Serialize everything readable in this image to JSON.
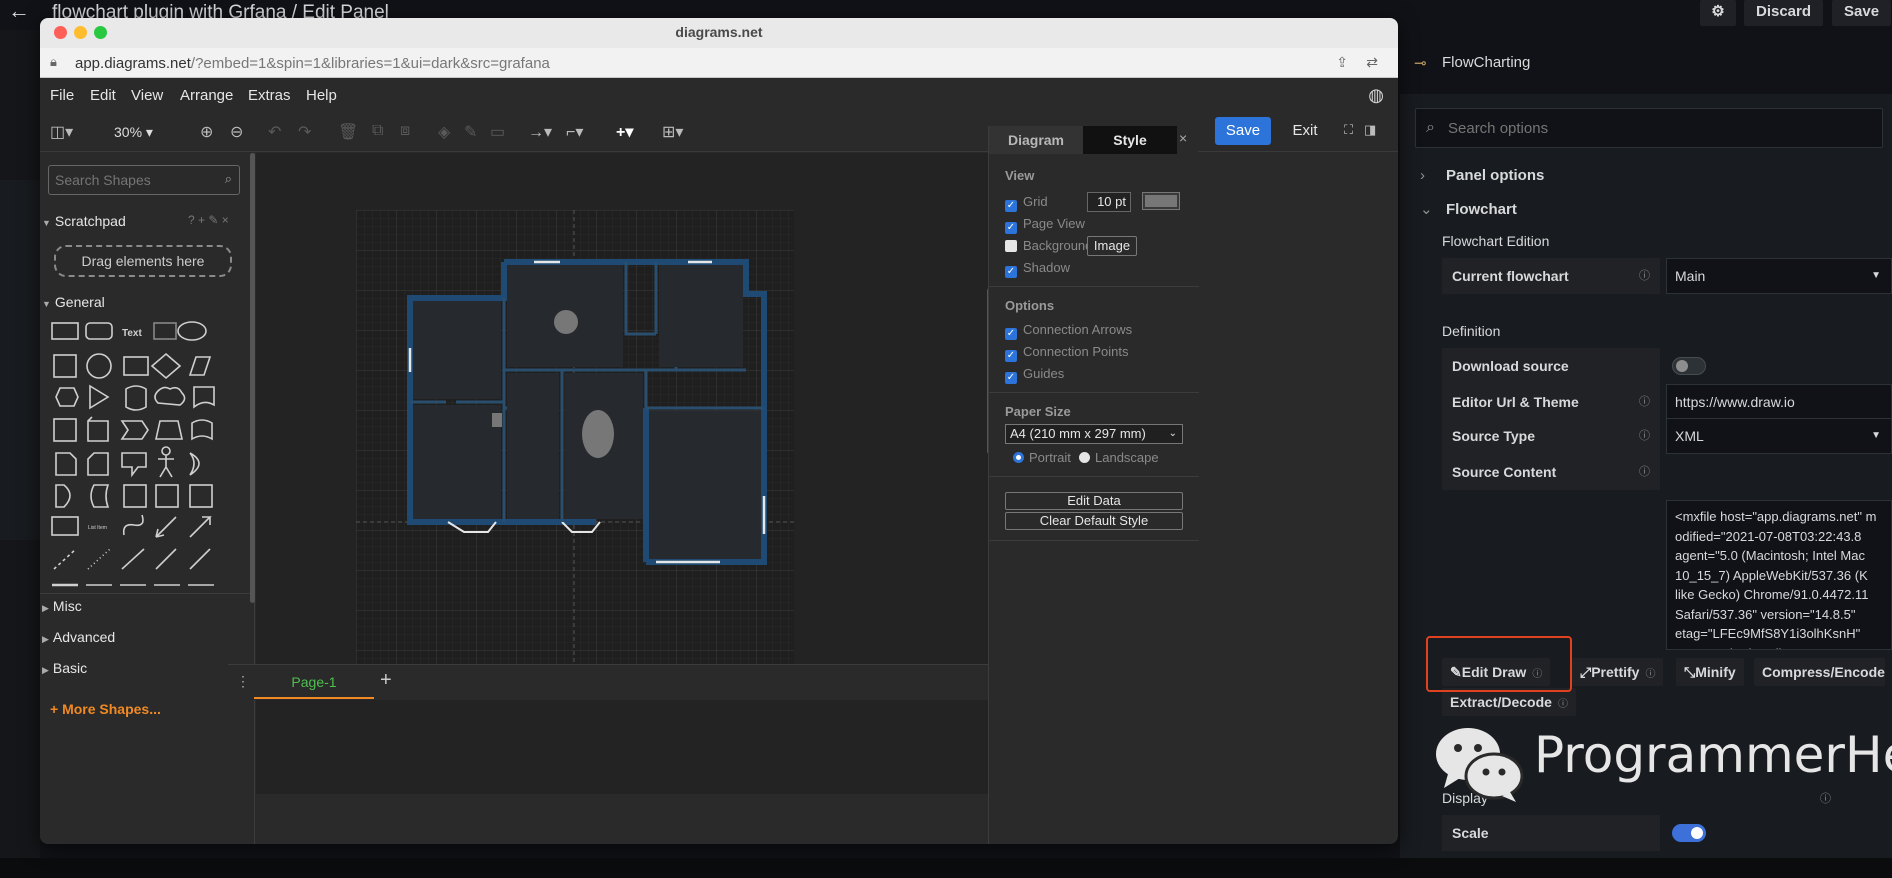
{
  "grafana": {
    "back_icon": "arrow-left-icon",
    "title": "flowchart plugin with Grfana / Edit Panel",
    "settings_icon": "gear-icon",
    "discard_label": "Discard",
    "save_label": "Save"
  },
  "options_pane": {
    "plugin_title": "FlowCharting",
    "search_placeholder": "Search options",
    "panel_options": "Panel options",
    "flowchart": "Flowchart",
    "flowchart_edition": "Flowchart Edition",
    "current_flowchart_label": "Current flowchart",
    "current_flowchart_value": "Main",
    "definition": "Definition",
    "download_source_label": "Download source",
    "download_source_on": false,
    "editor_url_label": "Editor Url & Theme",
    "editor_url_value": "https://www.draw.io",
    "source_type_label": "Source Type",
    "source_type_value": "XML",
    "source_content_label": "Source Content",
    "source_content_value": "<mxfile host=\"app.diagrams.net\" modified=\"2021-07-08T03:22:43.8\nagent=\"5.0 (Macintosh; Intel Mac\n10_15_7) AppleWebKit/537.36 (K\nlike Gecko) Chrome/91.0.4472.11\nSafari/537.36\" version=\"14.8.5\"\netag=\"LFEc9MfS8Y1i3olhKsnH\"\ntype=\"embed\"><diagram",
    "buttons": {
      "edit_draw": "Edit Draw",
      "prettify": "Prettify",
      "minify": "Minify",
      "compress": "Compress/Encode",
      "extract": "Extract/Decode"
    },
    "display": "Display",
    "scale_label": "Scale",
    "scale_on": true
  },
  "watermark": {
    "text": "ProgrammerHe"
  },
  "drawio": {
    "window_title": "diagrams.net",
    "url_host": "app.diagrams.net",
    "url_path": "/?embed=1&spin=1&libraries=1&ui=dark&src=grafana",
    "menu": [
      "File",
      "Edit",
      "View",
      "Arrange",
      "Extras",
      "Help"
    ],
    "zoom": "30%",
    "save_label": "Save",
    "exit_label": "Exit",
    "shape_search_placeholder": "Search Shapes",
    "scratchpad": "Scratchpad",
    "scratchpad_tools": "? + ✎ ×",
    "drag_here": "Drag elements here",
    "general": "General",
    "misc": "Misc",
    "advanced": "Advanced",
    "basic": "Basic",
    "more_shapes": "+ More Shapes...",
    "page_tab": "Page-1",
    "format": {
      "tab_diagram": "Diagram",
      "tab_style": "Style",
      "view": "View",
      "grid": "Grid",
      "grid_size": "10 pt",
      "page_view": "Page View",
      "background": "Background",
      "image_btn": "Image",
      "shadow": "Shadow",
      "options": "Options",
      "connection_arrows": "Connection Arrows",
      "connection_points": "Connection Points",
      "guides": "Guides",
      "paper_size": "Paper Size",
      "paper_value": "A4 (210 mm x 297 mm)",
      "portrait": "Portrait",
      "landscape": "Landscape",
      "edit_data": "Edit Data",
      "clear_default_style": "Clear Default Style"
    }
  },
  "colors": {
    "accent_blue": "#2d74da",
    "highlight_red": "#e0411e",
    "orange": "#f08a24",
    "wall_blue": "#1e4a73"
  }
}
